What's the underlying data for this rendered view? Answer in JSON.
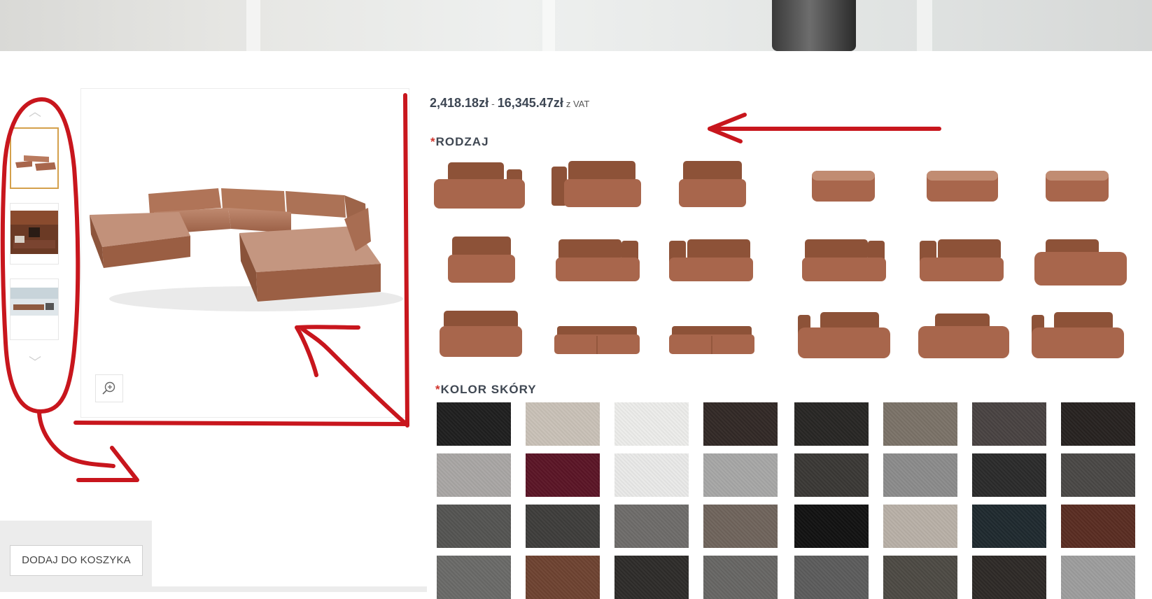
{
  "gallery": {
    "thumbnails": [
      {
        "name": "thumbnail-sofa-front",
        "active": true
      },
      {
        "name": "thumbnail-sofa-interior",
        "active": false
      },
      {
        "name": "thumbnail-sofa-room",
        "active": false
      }
    ],
    "up_arrow": "︿",
    "down_arrow": "﹀"
  },
  "product": {
    "price_min": "2,418.18zł",
    "price_separator": "-",
    "price_max": "16,345.47zł",
    "price_vat": "z VAT",
    "leather_color": "#a8664c"
  },
  "options": {
    "type_label": "RODZAJ",
    "type_required_mark": "*",
    "color_label": "KOLOR SKÓRY",
    "color_required_mark": "*"
  },
  "type_modules": [
    {
      "shape": "corner-left"
    },
    {
      "shape": "armchair-wide"
    },
    {
      "shape": "armchair-small"
    },
    {
      "shape": "ottoman"
    },
    {
      "shape": "ottoman-wide"
    },
    {
      "shape": "ottoman"
    },
    {
      "shape": "armchair-small"
    },
    {
      "shape": "armchair-arm-right"
    },
    {
      "shape": "armchair-arm-left"
    },
    {
      "shape": "armchair-arm-right"
    },
    {
      "shape": "armchair-arm-left"
    },
    {
      "shape": "chaise-right"
    },
    {
      "shape": "armchair-low"
    },
    {
      "shape": "two-seat"
    },
    {
      "shape": "two-seat"
    },
    {
      "shape": "chaise-left"
    },
    {
      "shape": "chaise-mid"
    },
    {
      "shape": "chaise-left"
    }
  ],
  "leather_colors": [
    "#1f1f1f",
    "#c9c1b7",
    "#ececea",
    "#322926",
    "#282624",
    "#7b7268",
    "#494342",
    "#272220",
    "#a9a6a4",
    "#5b1526",
    "#e9e9e8",
    "#a7a7a6",
    "#3a3835",
    "#8b8b8b",
    "#2b2b2b",
    "#4a4846",
    "#545452",
    "#3e3d3b",
    "#6e6c6a",
    "#6f645c",
    "#121212",
    "#b8b0a7",
    "#1f2a2f",
    "#5a2d22",
    "#6a6a68",
    "#6e4331",
    "#2e2c2a",
    "#676664",
    "#5c5c5c",
    "#4d4a44",
    "#2e2a27",
    "#9d9d9d"
  ],
  "cart": {
    "add_to_cart_label": "DODAJ DO KOSZYKA"
  }
}
